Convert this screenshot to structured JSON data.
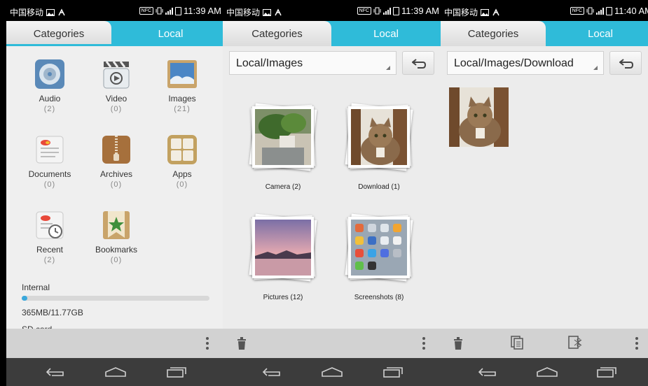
{
  "status": [
    {
      "carrier": "中国移动",
      "nfc": "NFC",
      "time": "11:39 AM"
    },
    {
      "carrier": "中国移动",
      "nfc": "NFC",
      "time": "11:39 AM"
    },
    {
      "carrier": "中国移动",
      "nfc": "NFC",
      "time": "11:40 AM"
    }
  ],
  "tabs": {
    "categories": "Categories",
    "local": "Local"
  },
  "categories": [
    {
      "name": "Audio",
      "count": "(2)",
      "icon": "audio-disc-icon"
    },
    {
      "name": "Video",
      "count": "(0)",
      "icon": "video-clapper-icon"
    },
    {
      "name": "Images",
      "count": "(21)",
      "icon": "images-picture-icon"
    },
    {
      "name": "Documents",
      "count": "(0)",
      "icon": "documents-icon"
    },
    {
      "name": "Archives",
      "count": "(0)",
      "icon": "archives-zipper-icon"
    },
    {
      "name": "Apps",
      "count": "(0)",
      "icon": "apps-grid-icon"
    },
    {
      "name": "Recent",
      "count": "(2)",
      "icon": "recent-clock-icon"
    },
    {
      "name": "Bookmarks",
      "count": "(0)",
      "icon": "bookmark-star-icon"
    }
  ],
  "storage": {
    "internal_label": "Internal",
    "internal_used": "365MB/11.77GB",
    "internal_fraction": 0.03,
    "sdcard_label": "SD card"
  },
  "screen2": {
    "path": "Local/Images",
    "folders": [
      {
        "label": "Camera (2)",
        "thumb": "plant-photo"
      },
      {
        "label": "Download (1)",
        "thumb": "cat-photo"
      },
      {
        "label": "Pictures (12)",
        "thumb": "sunset-lake-photo"
      },
      {
        "label": "Screenshots (8)",
        "thumb": "homescreen-photo"
      }
    ]
  },
  "screen3": {
    "path": "Local/Images/Download",
    "file_thumb": "cat-photo"
  },
  "colors": {
    "accent": "#2fbbd9",
    "navbar": "#3c3c3c",
    "actionbar": "#d2d2d2"
  }
}
